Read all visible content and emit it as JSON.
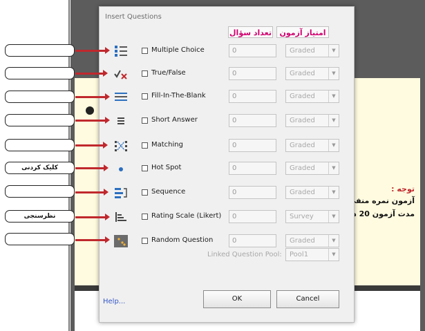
{
  "dialog": {
    "title": "Insert Questions",
    "header_count": "تعداد سؤال",
    "header_score": "امتیاز آزمون",
    "questions": [
      {
        "label": "Multiple Choice",
        "count": "0",
        "mode": "Graded",
        "icon": "multiple-choice-icon"
      },
      {
        "label": "True/False",
        "count": "0",
        "mode": "Graded",
        "icon": "true-false-icon"
      },
      {
        "label": "Fill-In-The-Blank",
        "count": "0",
        "mode": "Graded",
        "icon": "fill-in-blank-icon"
      },
      {
        "label": "Short Answer",
        "count": "0",
        "mode": "Graded",
        "icon": "short-answer-icon"
      },
      {
        "label": "Matching",
        "count": "0",
        "mode": "Graded",
        "icon": "matching-icon"
      },
      {
        "label": "Hot Spot",
        "count": "0",
        "mode": "Graded",
        "icon": "hot-spot-icon"
      },
      {
        "label": "Sequence",
        "count": "0",
        "mode": "Graded",
        "icon": "sequence-icon"
      },
      {
        "label": "Rating Scale (Likert)",
        "count": "0",
        "mode": "Survey",
        "icon": "rating-scale-icon"
      },
      {
        "label": "Random Question",
        "count": "0",
        "mode": "Graded",
        "icon": "random-question-icon"
      }
    ],
    "linked_pool_label": "Linked Question Pool:",
    "linked_pool_value": "Pool1",
    "help": "Help...",
    "ok": "OK",
    "cancel": "Cancel"
  },
  "callouts": [
    "",
    "",
    "",
    "",
    "",
    "کلیک کردنی",
    "",
    "نظرسنجی",
    ""
  ],
  "background_text": {
    "note": "توجه :",
    "line1": "آزمون نمره منفی",
    "line2": "مدت آزمون 20 د"
  },
  "colors": {
    "accent_red": "#c0282d",
    "header_pink": "#d0006f",
    "link_blue": "#3557c5"
  }
}
